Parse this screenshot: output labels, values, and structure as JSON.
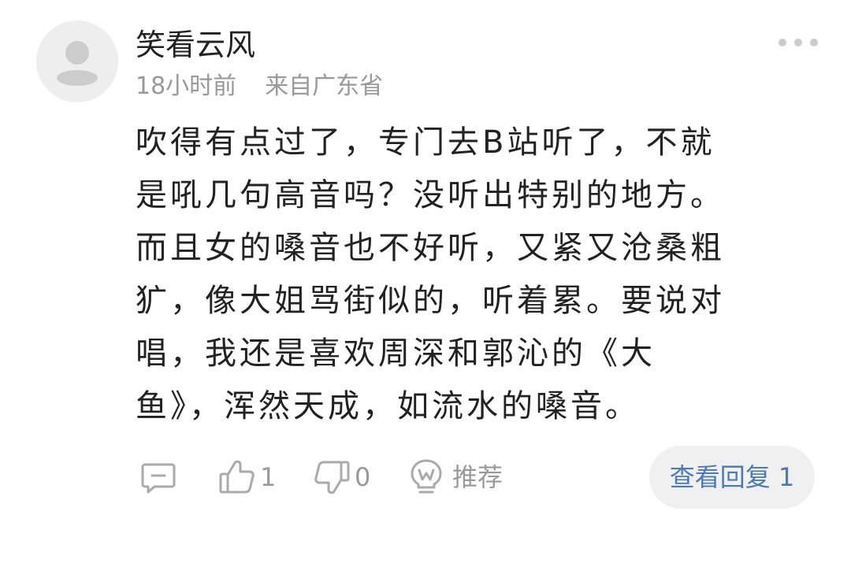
{
  "comment": {
    "username": "笑看云风",
    "time": "18小时前",
    "location": "来自广东省",
    "text_lines": [
      "吹得有点过了，专门去B站听了，不就",
      "是吼几句高音吗？没听出特别的地方。",
      "而且女的嗓音也不好听，又紧又沧桑粗",
      "犷，像大姐骂街似的，听着累。要说对",
      "唱，我还是喜欢周深和郭沁的《大",
      "鱼》，浑然天成，如流水的嗓音。"
    ]
  },
  "actions": {
    "like_count": "1",
    "dislike_count": "0",
    "recommend_label": "推荐",
    "view_replies_label": "查看回复 1"
  },
  "icons": {
    "avatar": "default-user-avatar",
    "more": "more-dots-icon",
    "reply": "comment-icon",
    "like": "thumbs-up-icon",
    "dislike": "thumbs-down-icon",
    "recommend": "recommend-icon"
  },
  "colors": {
    "text": "#222222",
    "secondary": "#999999",
    "link": "#4a7bb7",
    "pill_bg": "#f0f0f0",
    "avatar_bg": "#eeeeee"
  }
}
